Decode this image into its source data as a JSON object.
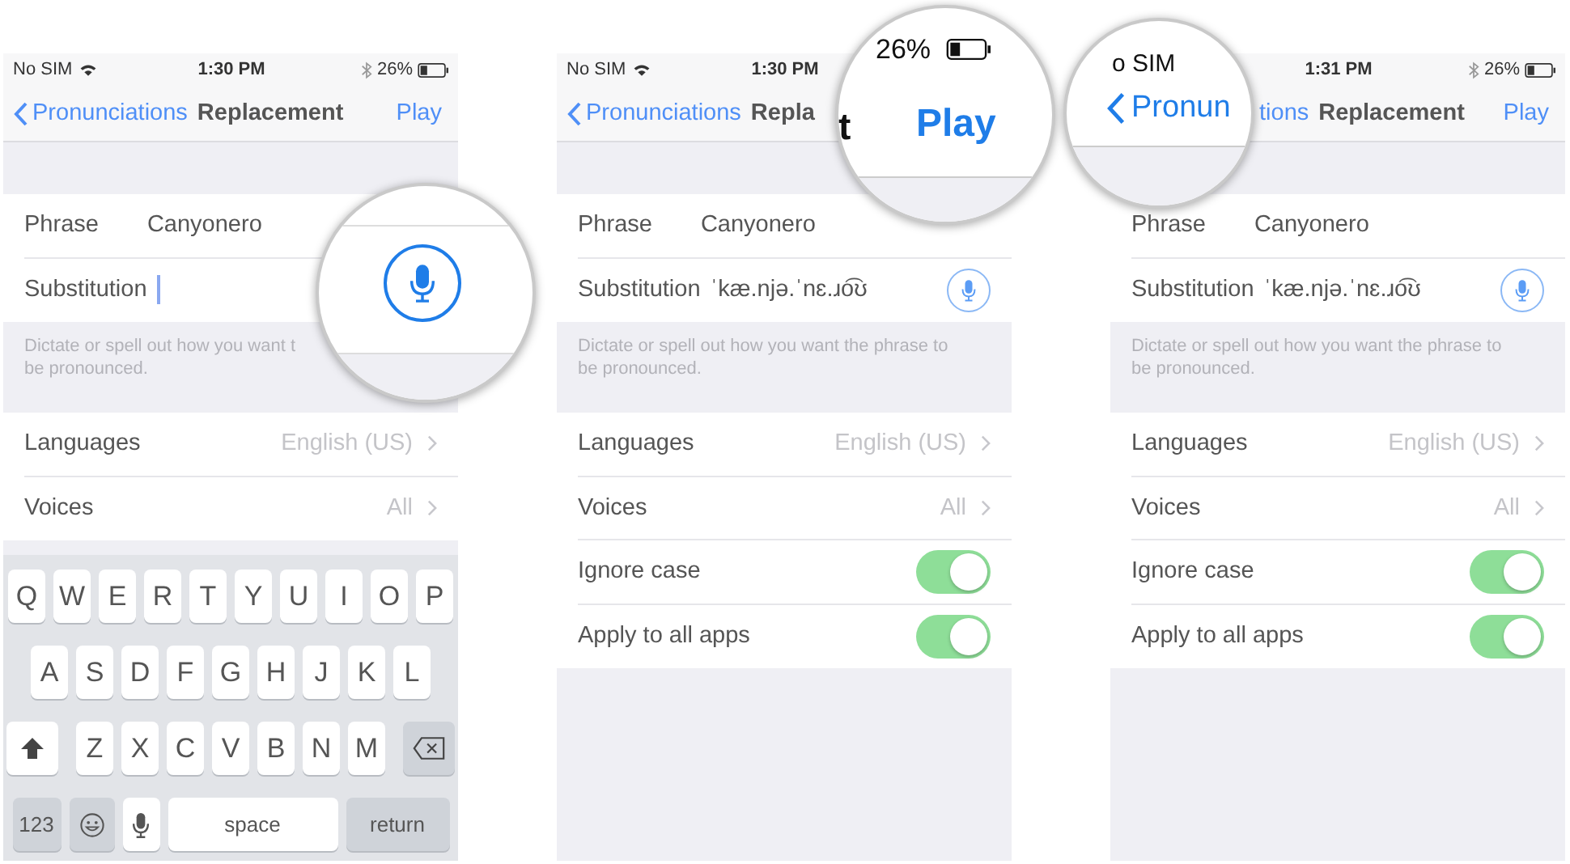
{
  "panels": [
    {
      "status": {
        "carrier": "No SIM",
        "wifi": true,
        "time": "1:30 PM",
        "bluetooth": true,
        "battery": "26%"
      },
      "nav": {
        "back": "Pronunciations",
        "title": "Replacement",
        "action": "Play"
      },
      "fields": [
        {
          "kind": "text",
          "label": "Phrase",
          "value": "Canyonero"
        },
        {
          "kind": "input",
          "label": "Substitution",
          "cursor": true,
          "mic": false
        }
      ],
      "footer": [
        "Dictate or spell out how you want t",
        "be pronounced."
      ],
      "settings": [
        {
          "kind": "detail",
          "label": "Languages",
          "value": "English (US)"
        },
        {
          "kind": "detail",
          "label": "Voices",
          "value": "All"
        }
      ],
      "keyboard": {
        "rows": [
          [
            "Q",
            "W",
            "E",
            "R",
            "T",
            "Y",
            "U",
            "I",
            "O",
            "P"
          ],
          [
            "A",
            "S",
            "D",
            "F",
            "G",
            "H",
            "J",
            "K",
            "L"
          ],
          [
            "Z",
            "X",
            "C",
            "V",
            "B",
            "N",
            "M"
          ]
        ],
        "numbers": "123",
        "space": "space",
        "return": "return"
      },
      "magnifier": {
        "kind": "mic"
      }
    },
    {
      "status": {
        "carrier": "No SIM",
        "wifi": true,
        "time": "1:30 PM",
        "bluetooth": false
      },
      "nav": {
        "back": "Pronunciations",
        "title": "Repla"
      },
      "fields": [
        {
          "kind": "text",
          "label": "Phrase",
          "value": "Canyonero"
        },
        {
          "kind": "input",
          "label": "Substitution",
          "value": "ˈkæ.njə.ˈnɛ.ɹo͡ʊ",
          "cursor": false,
          "mic": true
        }
      ],
      "footer": [
        "Dictate or spell out how you want the phrase to",
        "be pronounced."
      ],
      "settings": [
        {
          "kind": "detail",
          "label": "Languages",
          "value": "English (US)"
        },
        {
          "kind": "detail",
          "label": "Voices",
          "value": "All"
        },
        {
          "kind": "toggle",
          "label": "Ignore case",
          "on": true
        },
        {
          "kind": "toggle",
          "label": "Apply to all apps",
          "on": true
        }
      ],
      "magnifier": {
        "kind": "battery-play",
        "battery": "26%",
        "fragment": "t",
        "action": "Play"
      }
    },
    {
      "status": {
        "time": "1:31 PM",
        "bluetooth": true,
        "battery": "26%"
      },
      "nav": {
        "back": "tions",
        "covered": true,
        "title": "Replacement",
        "action": "Play"
      },
      "fields": [
        {
          "kind": "text",
          "label": "Phrase",
          "value": "Canyonero"
        },
        {
          "kind": "input",
          "label": "Substitution",
          "value": "ˈkæ.njə.ˈnɛ.ɹo͡ʊ",
          "cursor": false,
          "mic": true
        }
      ],
      "footer": [
        "Dictate or spell out how you want the phrase to",
        "be pronounced."
      ],
      "settings": [
        {
          "kind": "detail",
          "label": "Languages",
          "value": "English (US)"
        },
        {
          "kind": "detail",
          "label": "Voices",
          "value": "All"
        },
        {
          "kind": "toggle",
          "label": "Ignore case",
          "on": true
        },
        {
          "kind": "toggle",
          "label": "Apply to all apps",
          "on": true
        }
      ],
      "magnifier": {
        "kind": "back",
        "carrier": "o SIM",
        "back": "Pronun"
      }
    }
  ]
}
